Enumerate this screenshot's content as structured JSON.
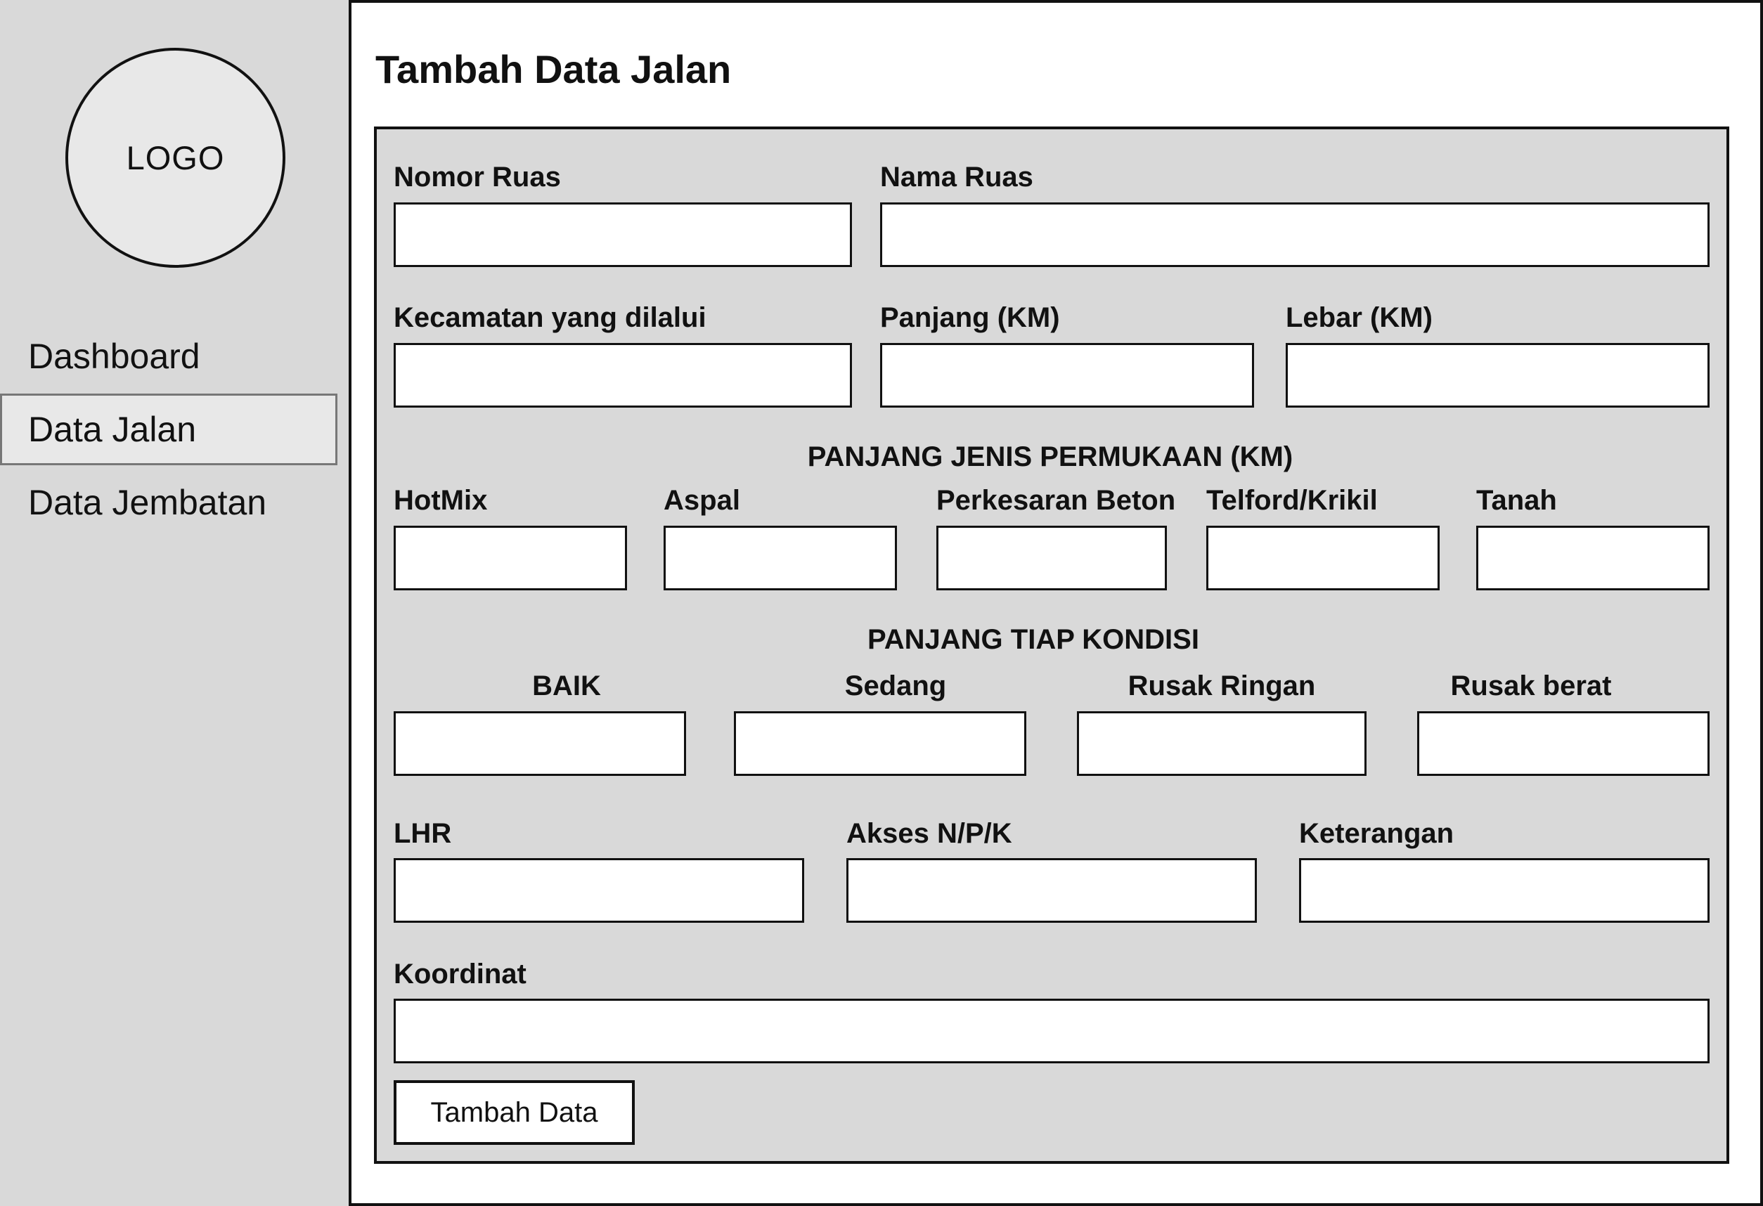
{
  "sidebar": {
    "logo_text": "LOGO",
    "items": [
      {
        "label": "Dashboard"
      },
      {
        "label": "Data Jalan",
        "active": true
      },
      {
        "label": "Data Jembatan"
      }
    ]
  },
  "page": {
    "title": "Tambah Data Jalan"
  },
  "form": {
    "nomor_ruas": "Nomor Ruas",
    "nama_ruas": "Nama Ruas",
    "kecamatan": "Kecamatan yang dilalui",
    "panjang": "Panjang (KM)",
    "lebar": "Lebar (KM)",
    "surface_section": "PANJANG JENIS PERMUKAAN (KM)",
    "hotmix": "HotMix",
    "aspal": "Aspal",
    "perkesaran_beton": "Perkesaran Beton",
    "telford": "Telford/Krikil",
    "tanah": "Tanah",
    "condition_section": "PANJANG TIAP KONDISI",
    "baik": "BAIK",
    "sedang": "Sedang",
    "rusak_ringan": "Rusak Ringan",
    "rusak_berat": "Rusak berat",
    "lhr": "LHR",
    "akses": "Akses N/P/K",
    "keterangan": "Keterangan",
    "koordinat": "Koordinat",
    "submit_label": "Tambah Data"
  },
  "colors": {
    "panel_bg": "#d9d9d9",
    "active_nav_bg": "#e8e8e8",
    "border": "#111111"
  }
}
